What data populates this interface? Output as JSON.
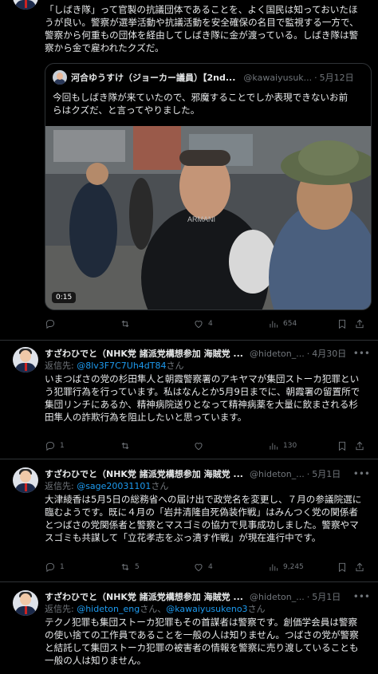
{
  "posts": [
    {
      "text_lines": [
        "「しばき隊」って官製の抗議団体であることを、よく国民は知っておいたほ",
        "うが良い。警察が選挙活動や抗議活動を安全確保の名目で監視する一方で、",
        "警察から何重もの団体を経由してしばき隊に金が渡っている。しばき隊は警",
        "察から金で雇われたクズだ。"
      ],
      "quote": {
        "name": "河合ゆうすけ（ジョーカー議員）【2nd...",
        "handle": "@kawaiyusuk...",
        "date": "5月12日",
        "text_lines": [
          "今回もしばき隊が来ていたので、邪魔することでしか表現できないお前",
          "らはクズだ、と言ってやりました。"
        ],
        "video_duration": "0:15"
      },
      "actions": {
        "replies": "",
        "reposts": "",
        "likes": "4",
        "views": "654"
      }
    },
    {
      "name": "すざわひでと（NHK党 諸派党構想参加 海賊党 ...",
      "handle": "@hideton_...",
      "date": "4月30日",
      "reply_prefix": "返信先: ",
      "reply_to": "@8lv3F7C7Uh4dT84",
      "reply_suffix": "さん",
      "text_lines": [
        "いまつばさの党の杉田隼人と朝霞警察署のアキヤマが集団ストーカ犯罪とい",
        "う犯罪行為を行っています。私はなんとか5月9日までに、朝霞署の留置所で",
        "集団リンチにあるか、精神病院送りとなって精神病薬を大量に飲まされる杉",
        "田隼人の詐欺行為を阻止したいと思っています。"
      ],
      "actions": {
        "replies": "1",
        "reposts": "",
        "likes": "",
        "views": "130"
      }
    },
    {
      "name": "すざわひでと（NHK党 諸派党構想参加 海賊党 ...",
      "handle": "@hideton_...",
      "date": "5月1日",
      "reply_prefix": "返信先: ",
      "reply_to": "@sage20031101",
      "reply_suffix": "さん",
      "text_lines": [
        "大津綾香は5月5日の総務省への届け出で政党名を変更し、７月の参議院選に",
        "臨むようです。既に４月の「岩井清隆自死偽装作戦」はみんつく党の関係者",
        "とつばさの党関係者と警察とマスゴミの協力で見事成功しました。警察やマ",
        "スゴミも共謀して「立花孝志をぶっ潰す作戦」が現在進行中です。"
      ],
      "actions": {
        "replies": "1",
        "reposts": "5",
        "likes": "4",
        "views": "9,245"
      }
    },
    {
      "name": "すざわひでと（NHK党 諸派党構想参加 海賊党 ...",
      "handle": "@hideton_...",
      "date": "5月1日",
      "reply_prefix": "返信先: ",
      "reply_to": "@hideton_eng",
      "reply_mid": "さん、",
      "reply_to2": "@kawaiyusukeno3",
      "reply_suffix": "さん",
      "text_lines": [
        "テクノ犯罪も集団ストーカ犯罪もその首謀者は警察です。創価学会員は警察",
        "の使い捨ての工作員であることを一般の人は知りません。つばさの党が警察",
        "と結託して集団ストーカ犯罪の被害者の情報を警察に売り渡していることも",
        "一般の人は知りません。"
      ]
    }
  ],
  "colors": {
    "link": "#1d9bf0",
    "muted": "#71767b",
    "background": "#000000",
    "border": "#2f3336"
  },
  "icons": [
    "reply-icon",
    "repost-icon",
    "like-icon",
    "views-icon",
    "bookmark-icon",
    "share-icon",
    "more-icon"
  ]
}
